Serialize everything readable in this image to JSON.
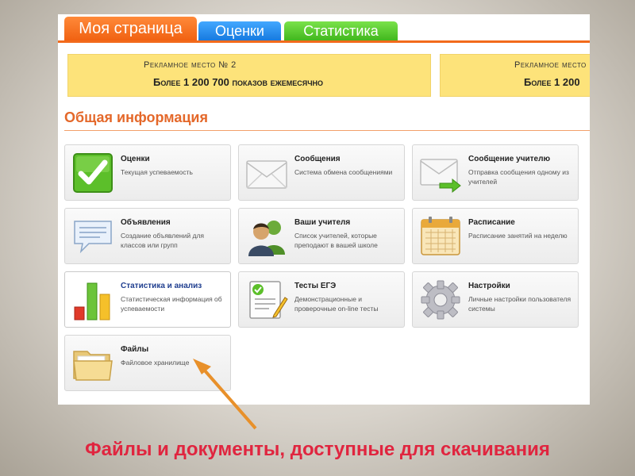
{
  "tabs": {
    "my_page": "Моя страница",
    "grades": "Оценки",
    "statistics": "Статистика"
  },
  "ads": [
    {
      "title": "Рекламное место № 2",
      "text": "Более 1 200 700 показов ежемесячно"
    },
    {
      "title": "Рекламное место",
      "text": "Более 1 200"
    }
  ],
  "section": {
    "title": "Общая информация"
  },
  "tiles": [
    {
      "title": "Оценки",
      "desc": "Текущая успеваемость",
      "icon": "checkmark-icon"
    },
    {
      "title": "Сообщения",
      "desc": "Система обмена сообщениями",
      "icon": "envelope-icon"
    },
    {
      "title": "Сообщение учителю",
      "desc": "Отправка сообщения одному из учителей",
      "icon": "envelope-arrow-icon"
    },
    {
      "title": "Объявления",
      "desc": "Создание объявлений для классов или групп",
      "icon": "speech-bubble-icon"
    },
    {
      "title": "Ваши учителя",
      "desc": "Список учителей, которые преподают в вашей школе",
      "icon": "people-icon"
    },
    {
      "title": "Расписание",
      "desc": "Расписание занятий на неделю",
      "icon": "calendar-icon"
    },
    {
      "title": "Статистика и анализ",
      "desc": "Статистическая информация об успеваемости",
      "icon": "bar-chart-icon"
    },
    {
      "title": "Тесты ЕГЭ",
      "desc": "Демонстрационные и проверочные on-line тесты",
      "icon": "test-sheet-icon"
    },
    {
      "title": "Настройки",
      "desc": "Личные настройки пользователя системы",
      "icon": "gear-icon"
    },
    {
      "title": "Файлы",
      "desc": "Файловое хранилище",
      "icon": "folder-icon"
    }
  ],
  "caption": "Файлы и документы, доступные для скачивания",
  "colors": {
    "accent": "#f26a1b",
    "caption": "#e0253f",
    "ad_bg": "#fde37a"
  }
}
